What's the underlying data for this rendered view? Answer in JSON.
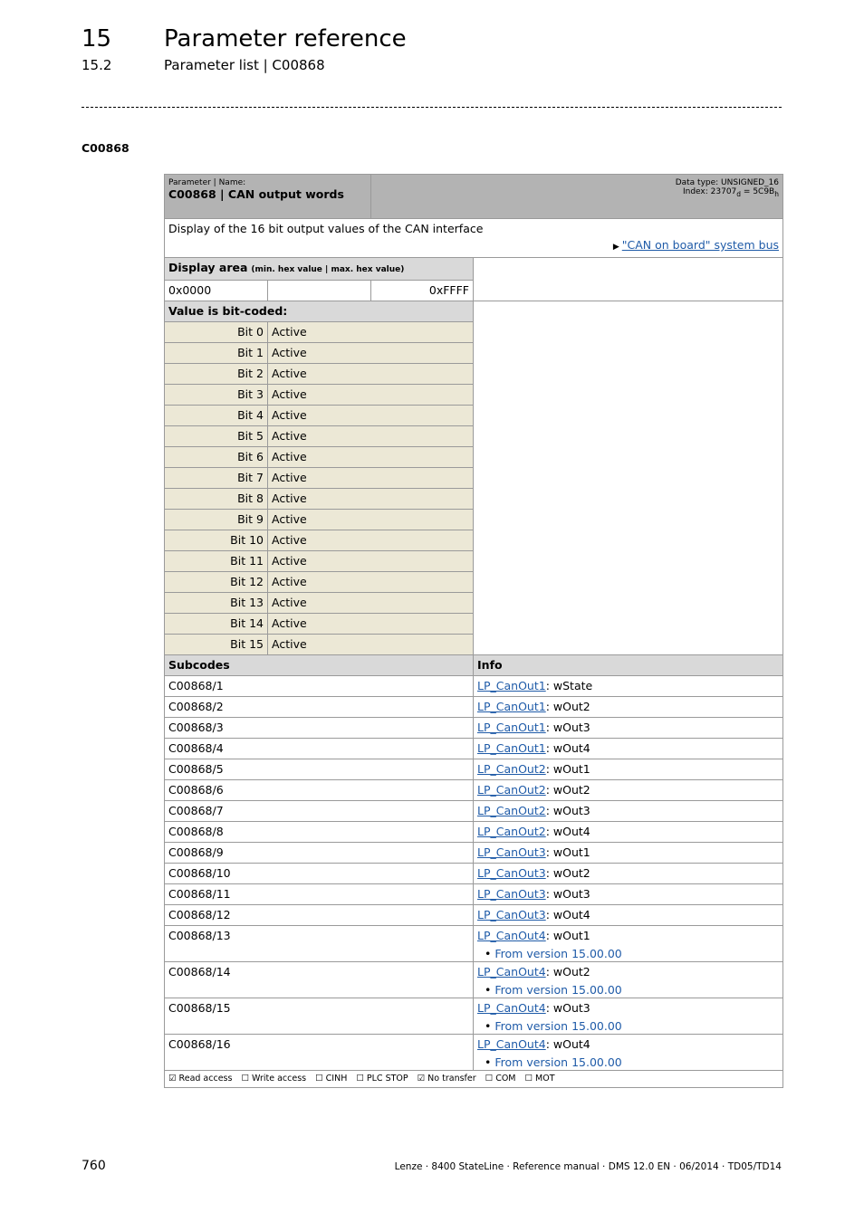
{
  "header": {
    "chapter_num": "15",
    "chapter_title": "Parameter reference",
    "section_num": "15.2",
    "section_title": "Parameter list | C00868"
  },
  "code_heading": "C00868",
  "param": {
    "name_caption": "Parameter | Name:",
    "name": "C00868 | CAN output words",
    "data_type": "Data type: UNSIGNED_16",
    "index_prefix": "Index: 23707",
    "index_sub1": "d",
    "index_mid": " = 5C9B",
    "index_sub2": "h",
    "description": "Display of the 16 bit output values of the CAN interface",
    "link": "\"CAN on board\" system bus"
  },
  "display_area": {
    "label": "Display area",
    "hint": "(min. hex value | max. hex value)",
    "min": "0x0000",
    "max": "0xFFFF"
  },
  "bitcoded_label": "Value is bit-coded:",
  "bits": [
    {
      "bit": "Bit 0",
      "value": "Active"
    },
    {
      "bit": "Bit 1",
      "value": "Active"
    },
    {
      "bit": "Bit 2",
      "value": "Active"
    },
    {
      "bit": "Bit 3",
      "value": "Active"
    },
    {
      "bit": "Bit 4",
      "value": "Active"
    },
    {
      "bit": "Bit 5",
      "value": "Active"
    },
    {
      "bit": "Bit 6",
      "value": "Active"
    },
    {
      "bit": "Bit 7",
      "value": "Active"
    },
    {
      "bit": "Bit 8",
      "value": "Active"
    },
    {
      "bit": "Bit 9",
      "value": "Active"
    },
    {
      "bit": "Bit 10",
      "value": "Active"
    },
    {
      "bit": "Bit 11",
      "value": "Active"
    },
    {
      "bit": "Bit 12",
      "value": "Active"
    },
    {
      "bit": "Bit 13",
      "value": "Active"
    },
    {
      "bit": "Bit 14",
      "value": "Active"
    },
    {
      "bit": "Bit 15",
      "value": "Active"
    }
  ],
  "subcodes_header": "Subcodes",
  "info_header": "Info",
  "subcodes": [
    {
      "code": "C00868/1",
      "link": "LP_CanOut1",
      "info": ": wState",
      "note": ""
    },
    {
      "code": "C00868/2",
      "link": "LP_CanOut1",
      "info": ": wOut2",
      "note": ""
    },
    {
      "code": "C00868/3",
      "link": "LP_CanOut1",
      "info": ": wOut3",
      "note": ""
    },
    {
      "code": "C00868/4",
      "link": "LP_CanOut1",
      "info": ": wOut4",
      "note": ""
    },
    {
      "code": "C00868/5",
      "link": "LP_CanOut2",
      "info": ": wOut1",
      "note": ""
    },
    {
      "code": "C00868/6",
      "link": "LP_CanOut2",
      "info": ": wOut2",
      "note": ""
    },
    {
      "code": "C00868/7",
      "link": "LP_CanOut2",
      "info": ": wOut3",
      "note": ""
    },
    {
      "code": "C00868/8",
      "link": "LP_CanOut2",
      "info": ": wOut4",
      "note": ""
    },
    {
      "code": "C00868/9",
      "link": "LP_CanOut3",
      "info": ": wOut1",
      "note": ""
    },
    {
      "code": "C00868/10",
      "link": "LP_CanOut3",
      "info": ": wOut2",
      "note": ""
    },
    {
      "code": "C00868/11",
      "link": "LP_CanOut3",
      "info": ": wOut3",
      "note": ""
    },
    {
      "code": "C00868/12",
      "link": "LP_CanOut3",
      "info": ": wOut4",
      "note": ""
    },
    {
      "code": "C00868/13",
      "link": "LP_CanOut4",
      "info": ": wOut1",
      "note": "From version 15.00.00"
    },
    {
      "code": "C00868/14",
      "link": "LP_CanOut4",
      "info": ": wOut2",
      "note": "From version 15.00.00"
    },
    {
      "code": "C00868/15",
      "link": "LP_CanOut4",
      "info": ": wOut3",
      "note": "From version 15.00.00"
    },
    {
      "code": "C00868/16",
      "link": "LP_CanOut4",
      "info": ": wOut4",
      "note": "From version 15.00.00"
    }
  ],
  "access_flags": [
    {
      "checked": true,
      "label": "Read access"
    },
    {
      "checked": false,
      "label": "Write access"
    },
    {
      "checked": false,
      "label": "CINH"
    },
    {
      "checked": false,
      "label": "PLC STOP"
    },
    {
      "checked": true,
      "label": "No transfer"
    },
    {
      "checked": false,
      "label": "COM"
    },
    {
      "checked": false,
      "label": "MOT"
    }
  ],
  "footer": {
    "page": "760",
    "text": "Lenze · 8400 StateLine · Reference manual · DMS 12.0 EN · 06/2014 · TD05/TD14"
  }
}
